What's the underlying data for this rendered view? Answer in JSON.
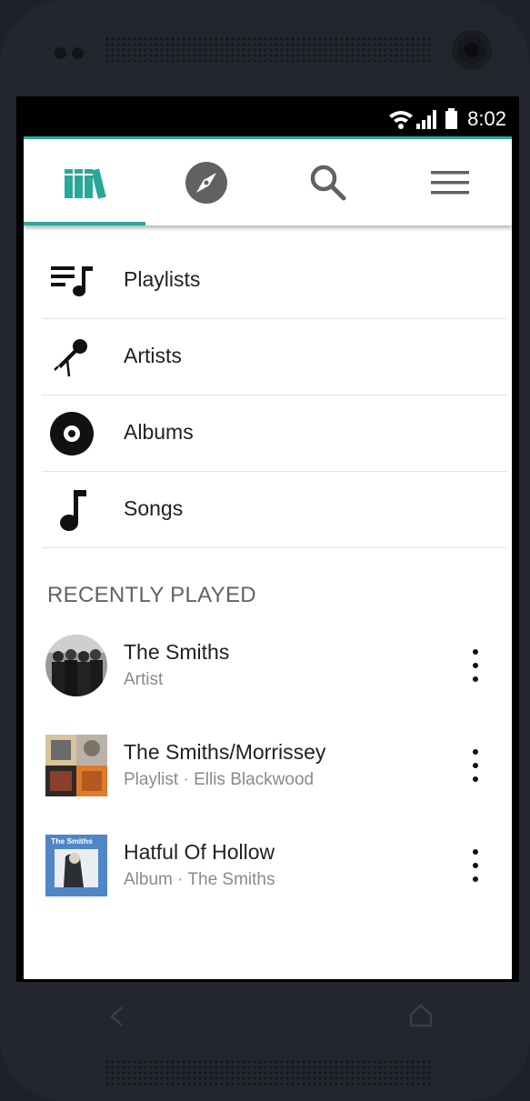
{
  "status_bar": {
    "time": "8:02"
  },
  "tabs": [
    {
      "name": "library",
      "icon": "library-books-icon",
      "selected": true
    },
    {
      "name": "explore",
      "icon": "compass-icon",
      "selected": false
    },
    {
      "name": "search",
      "icon": "search-icon",
      "selected": false
    },
    {
      "name": "menu",
      "icon": "hamburger-menu-icon",
      "selected": false
    }
  ],
  "menu": {
    "items": [
      {
        "label": "Playlists",
        "icon": "playlist-icon"
      },
      {
        "label": "Artists",
        "icon": "microphone-icon"
      },
      {
        "label": "Albums",
        "icon": "vinyl-disc-icon"
      },
      {
        "label": "Songs",
        "icon": "music-note-icon"
      }
    ]
  },
  "recently_played": {
    "title": "RECENTLY PLAYED",
    "items": [
      {
        "title": "The Smiths",
        "type": "Artist",
        "owner": "",
        "thumb": "artist-photo"
      },
      {
        "title": "The Smiths/Morrissey",
        "type": "Playlist",
        "owner": "Ellis Blackwood",
        "thumb": "playlist-collage"
      },
      {
        "title": "Hatful Of Hollow",
        "type": "Album",
        "owner": "The Smiths",
        "thumb": "album-cover",
        "thumb_text": "The Smiths"
      }
    ]
  },
  "colors": {
    "accent": "#2ba79a",
    "text_primary": "#212121",
    "text_secondary": "#8a8a8a",
    "section_title": "#5f6368"
  }
}
